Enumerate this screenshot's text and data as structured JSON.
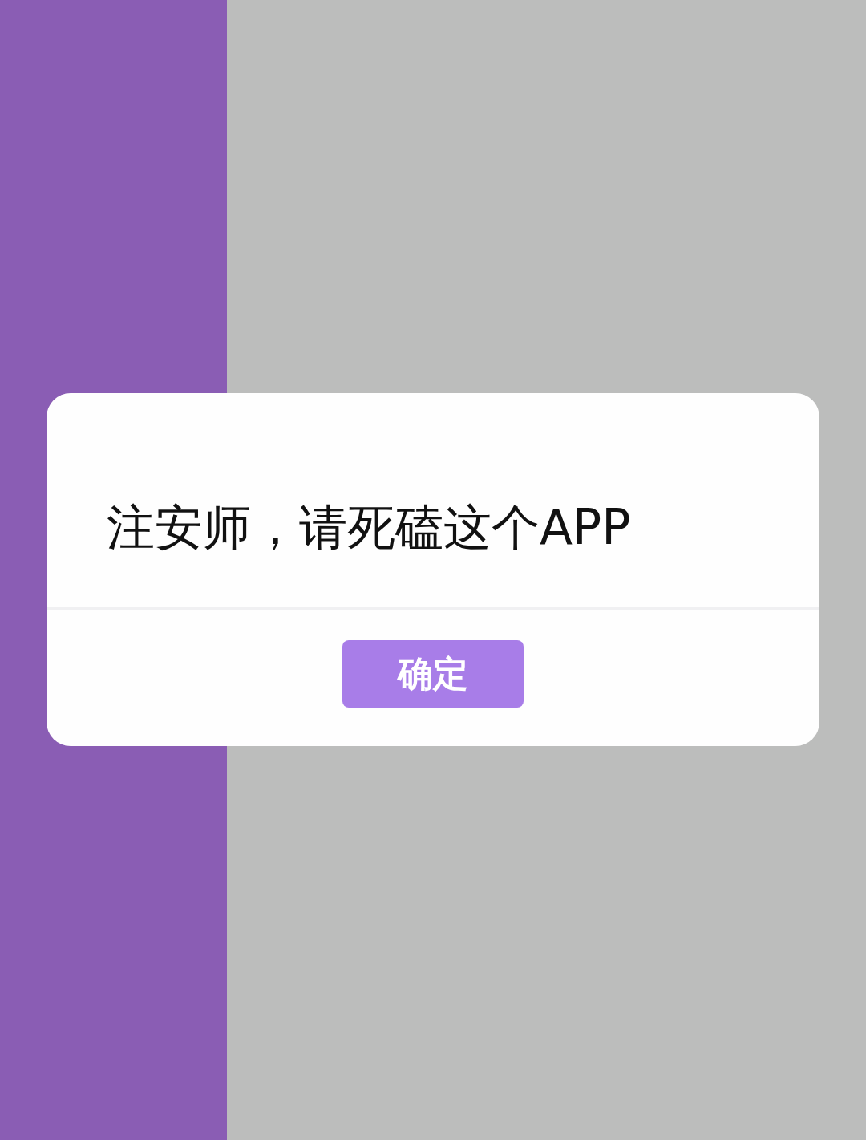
{
  "dialog": {
    "message": "注安师，请死磕这个APP",
    "buttons": [
      {
        "label": "确定"
      }
    ]
  }
}
